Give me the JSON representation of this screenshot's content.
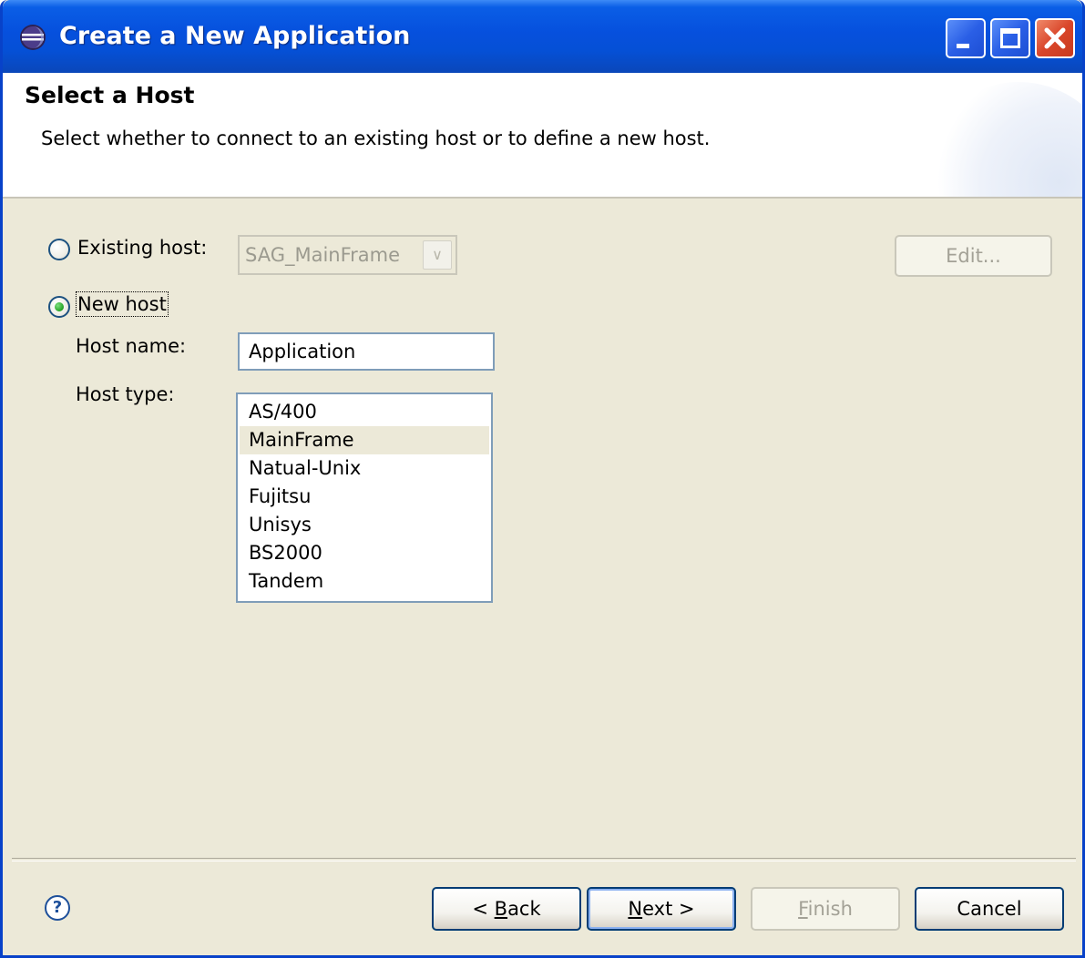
{
  "window": {
    "title": "Create a New Application",
    "controls": [
      "minimize-icon",
      "maximize-icon",
      "close-icon"
    ]
  },
  "header": {
    "title": "Select a Host",
    "description": "Select whether to connect to an existing host or to define a new host."
  },
  "existing_host": {
    "label": "Existing host:",
    "selected": false,
    "combo_value": "SAG_MainFrame",
    "edit_button": "Edit..."
  },
  "new_host": {
    "label": "New host",
    "selected": true,
    "host_name_label": "Host name:",
    "host_name_value": "Application",
    "host_type_label": "Host type:",
    "host_types": [
      "AS/400",
      "MainFrame",
      "Natual-Unix",
      "Fujitsu",
      "Unisys",
      "BS2000",
      "Tandem"
    ],
    "selected_host_type": "MainFrame"
  },
  "footer": {
    "help_icon": "help-icon",
    "back_prefix": "< ",
    "back_mnemonic": "B",
    "back_rest": "ack",
    "next_mnemonic": "N",
    "next_rest": "ext >",
    "finish_mnemonic": "F",
    "finish_rest": "inish",
    "cancel": "Cancel"
  },
  "colors": {
    "titlebar": "#0650dd",
    "dialog_bg": "#ece9d8",
    "button_border": "#003c74"
  }
}
